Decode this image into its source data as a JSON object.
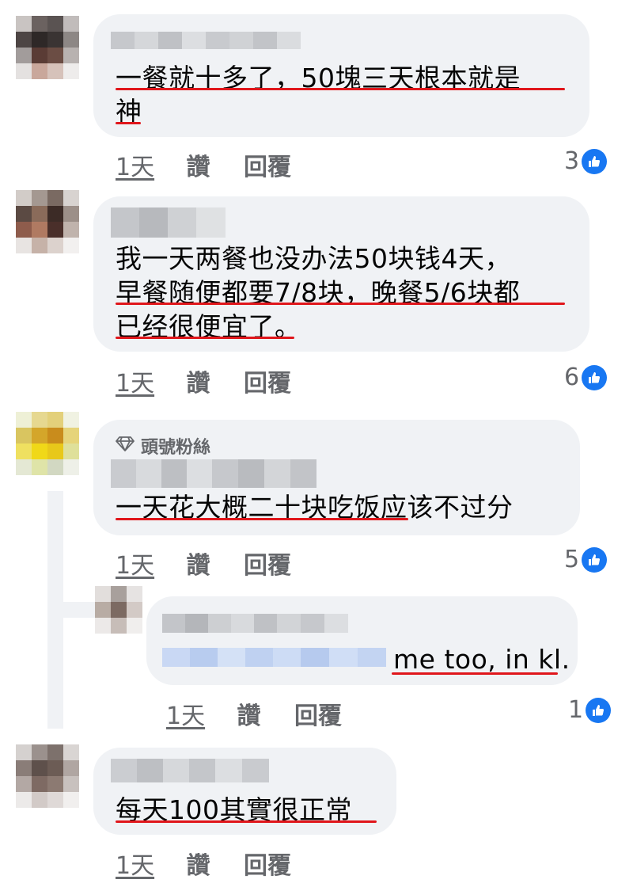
{
  "comments": [
    {
      "lines": [
        "一餐就十多了，50塊三天根本就是",
        "神"
      ],
      "time": "1天",
      "like_label": "讚",
      "reply_label": "回覆",
      "reactions": "3"
    },
    {
      "lines": [
        "我一天两餐也没办法50块钱4天，",
        "早餐随便都要7/8块，晚餐5/6块都",
        "已经很便宜了。"
      ],
      "time": "1天",
      "like_label": "讚",
      "reply_label": "回覆",
      "reactions": "6"
    },
    {
      "badge": "頭號粉絲",
      "lines": [
        "一天花大概二十块吃饭应该不过分"
      ],
      "time": "1天",
      "like_label": "讚",
      "reply_label": "回覆",
      "reactions": "5"
    },
    {
      "lines": [
        "me too, in kl."
      ],
      "time": "1天",
      "like_label": "讚",
      "reply_label": "回覆",
      "reactions": "1"
    },
    {
      "lines": [
        "每天100其實很正常"
      ],
      "time": "1天",
      "like_label": "讚",
      "reply_label": "回覆"
    }
  ],
  "colors": {
    "underline": "#e0161b",
    "like_blue": "#1877f2",
    "bubble": "#f0f2f5",
    "meta": "#65676b"
  },
  "icons": {
    "reaction": "thumbs-up-icon",
    "badge": "diamond-icon"
  }
}
